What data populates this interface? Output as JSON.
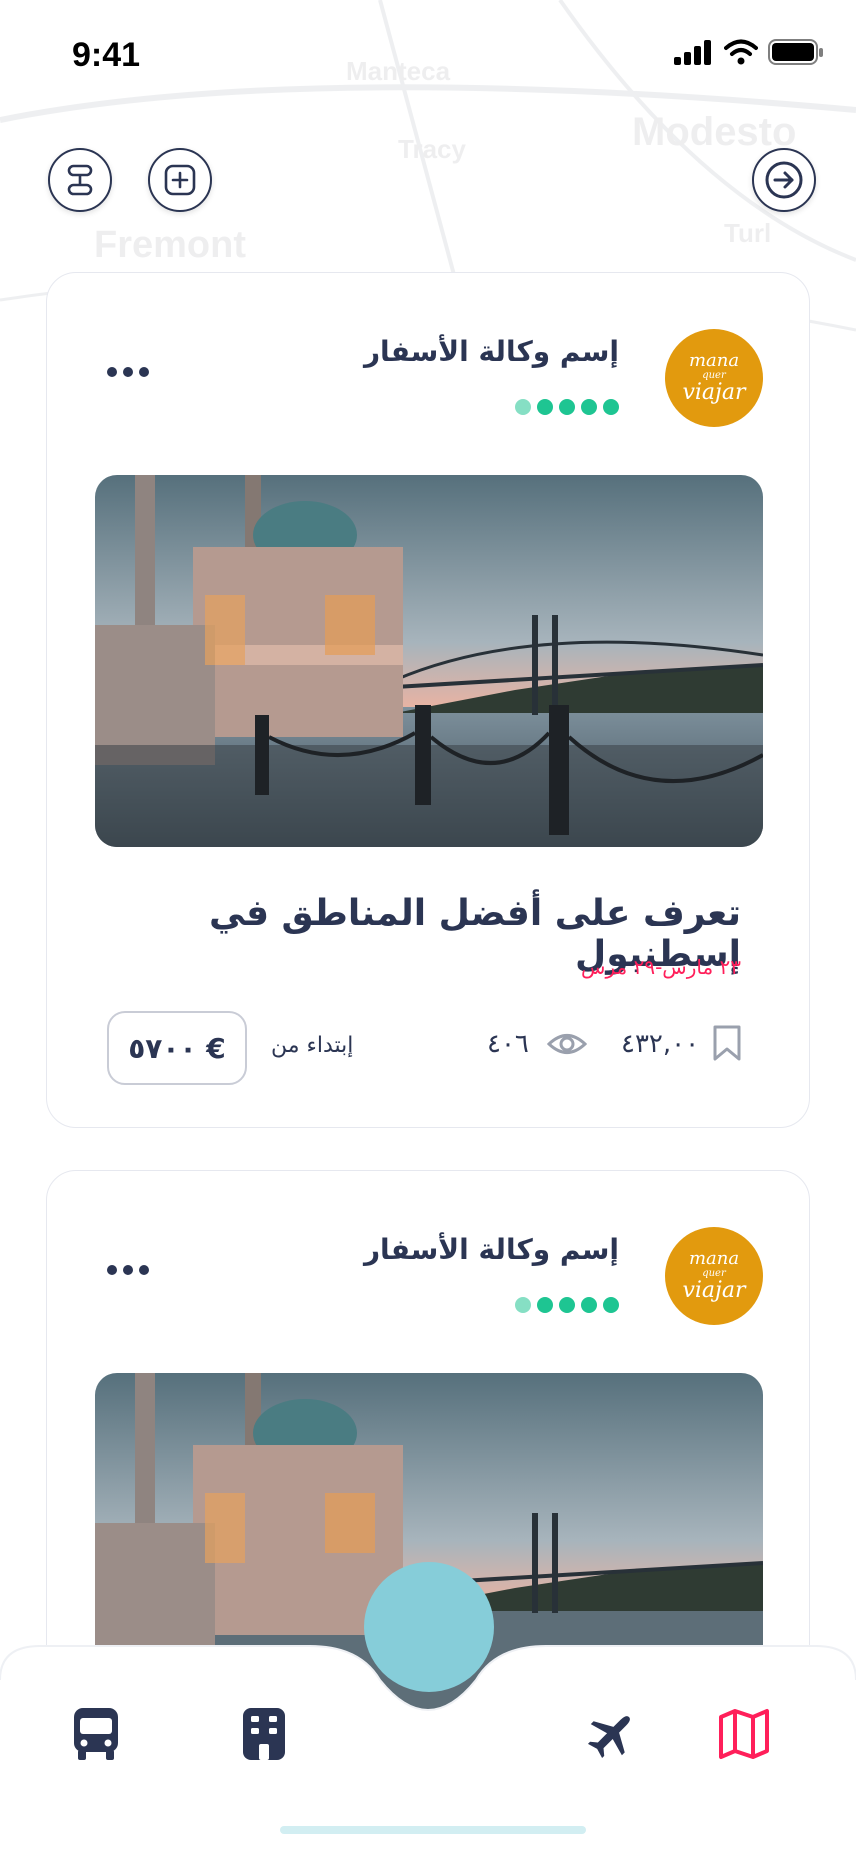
{
  "status_bar": {
    "time": "9:41"
  },
  "map_labels": [
    "Manteca",
    "Tracy",
    "Modesto",
    "Fremont",
    "Turl"
  ],
  "cards": [
    {
      "agency_name": "إسم وكالة الأسفار",
      "logo_text": [
        "mana",
        "quer",
        "viajar"
      ],
      "rating": 5,
      "title": "تعرف على أفضل المناطق في إسطنبول",
      "dates": "٢٣ مارس-٢٩ مرس",
      "price": "٥٧٠٠ €",
      "price_prefix": "إبتداء من",
      "views": "٤٠٦",
      "saves": "٤٣٢,٠٠"
    },
    {
      "agency_name": "إسم وكالة الأسفار",
      "logo_text": [
        "mana",
        "quer",
        "viajar"
      ],
      "rating": 5
    }
  ],
  "icons": {
    "top_left_1": "route-icon",
    "top_left_2": "add-square-icon",
    "top_right": "arrow-right-circle-icon",
    "nav": [
      "bus-icon",
      "building-icon",
      "airplane-icon",
      "map-icon"
    ]
  },
  "colors": {
    "primary": "#2b3553",
    "accent": "#ff1f5a",
    "rating": "#1ec592",
    "fab": "#86cdd9",
    "logo": "#e29a0e"
  }
}
